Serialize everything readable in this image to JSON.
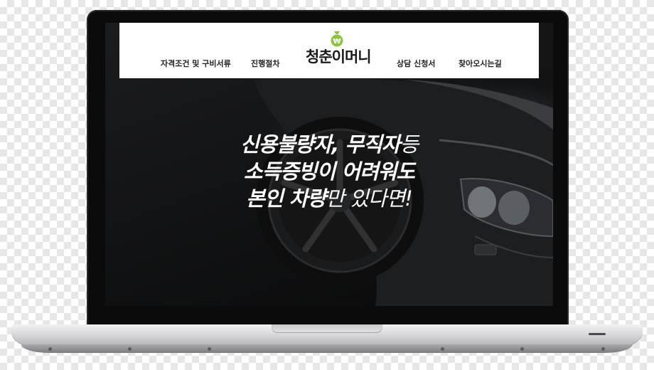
{
  "window": {
    "header": {
      "nav_left": [
        "자격조건 및 구비서류",
        "진행절차"
      ],
      "nav_right": [
        "상담 신청서",
        "찾아오시는길"
      ],
      "logo_text": "청춘이머니",
      "logo_icon": "money-bag-icon",
      "logo_color": "#8cc63f"
    },
    "hero": {
      "line1_bold": "신용불량자, 무직자",
      "line1_thin": "등",
      "line2": "소득증빙이 어려워도",
      "line3_bold": "본인 차량",
      "line3_thin": "만 있다면!"
    }
  }
}
